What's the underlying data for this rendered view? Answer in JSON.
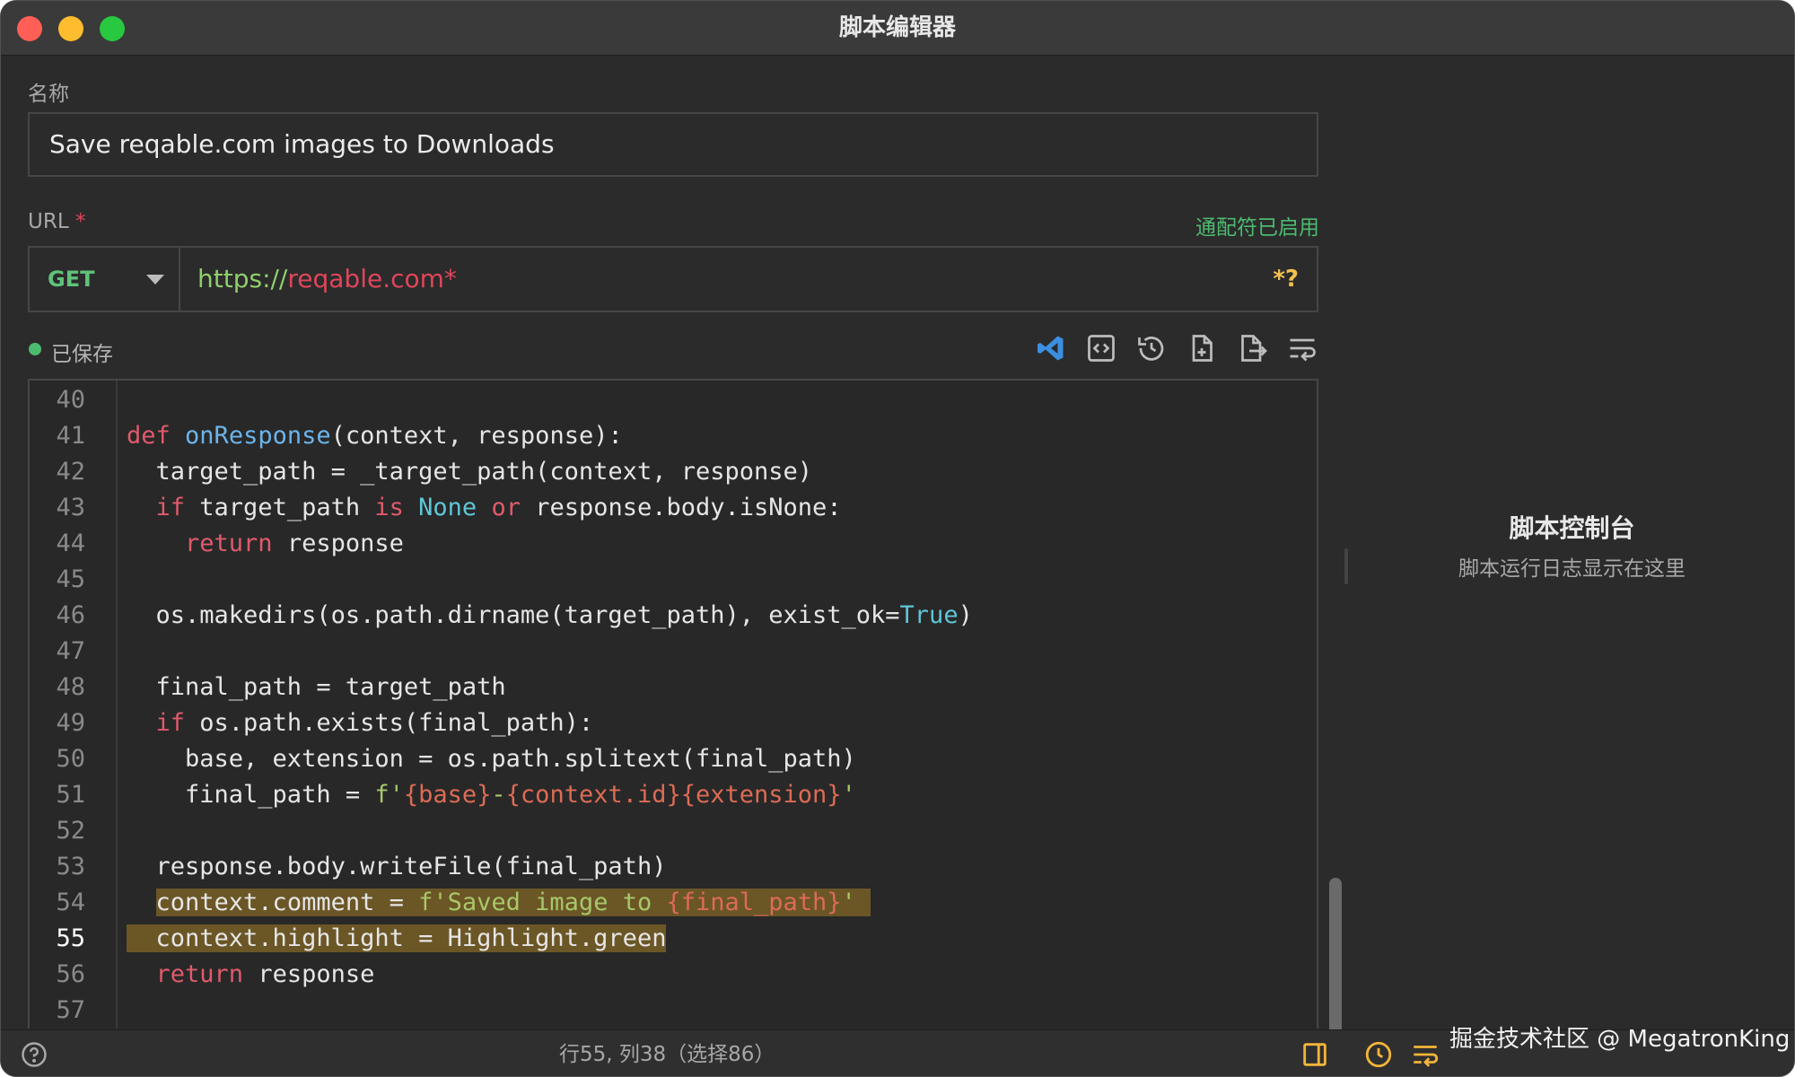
{
  "window": {
    "title": "脚本编辑器"
  },
  "form": {
    "name_label": "名称",
    "name_value": "Save reqable.com images to Downloads",
    "url_label": "URL",
    "url_required": "*",
    "wildcard_status": "通配符已启用",
    "method": "GET",
    "url_scheme": "https://",
    "url_host": "reqable.com*",
    "wildcard_button": "*?"
  },
  "status": {
    "saved": "已保存"
  },
  "toolbar": {
    "icons": [
      "vscode-icon",
      "code-block-icon",
      "history-icon",
      "import-file-icon",
      "export-file-icon",
      "word-wrap-icon"
    ]
  },
  "editor": {
    "current_line": 55,
    "lines": [
      {
        "n": 40,
        "tokens": []
      },
      {
        "n": 41,
        "tokens": [
          [
            "def",
            "k"
          ],
          [
            " ",
            ""
          ],
          [
            "onResponse",
            "f"
          ],
          [
            "(context, response):",
            ""
          ]
        ]
      },
      {
        "n": 42,
        "tokens": [
          [
            "  target_path = _target_path(context, response)",
            ""
          ]
        ]
      },
      {
        "n": 43,
        "tokens": [
          [
            "  ",
            ""
          ],
          [
            "if",
            "k"
          ],
          [
            " target_path ",
            ""
          ],
          [
            "is",
            "k"
          ],
          [
            " ",
            ""
          ],
          [
            "None",
            "c"
          ],
          [
            " ",
            ""
          ],
          [
            "or",
            "k"
          ],
          [
            " response.body.isNone:",
            ""
          ]
        ]
      },
      {
        "n": 44,
        "tokens": [
          [
            "    ",
            ""
          ],
          [
            "return",
            "k"
          ],
          [
            " response",
            ""
          ]
        ]
      },
      {
        "n": 45,
        "tokens": []
      },
      {
        "n": 46,
        "tokens": [
          [
            "  os.makedirs(os.path.dirname(target_path), exist_ok=",
            ""
          ],
          [
            "True",
            "c"
          ],
          [
            ")",
            ""
          ]
        ]
      },
      {
        "n": 47,
        "tokens": []
      },
      {
        "n": 48,
        "tokens": [
          [
            "  final_path = target_path",
            ""
          ]
        ]
      },
      {
        "n": 49,
        "tokens": [
          [
            "  ",
            ""
          ],
          [
            "if",
            "k"
          ],
          [
            " os.path.exists(final_path):",
            ""
          ]
        ]
      },
      {
        "n": 50,
        "tokens": [
          [
            "    base, extension = os.path.splitext(final_path)",
            ""
          ]
        ]
      },
      {
        "n": 51,
        "tokens": [
          [
            "    final_path = ",
            ""
          ],
          [
            "f'",
            "s"
          ],
          [
            "{base}",
            "i"
          ],
          [
            "-",
            "s"
          ],
          [
            "{context.id}",
            "i"
          ],
          [
            "{extension}",
            "i"
          ],
          [
            "'",
            "s"
          ]
        ]
      },
      {
        "n": 52,
        "tokens": []
      },
      {
        "n": 53,
        "tokens": [
          [
            "  response.body.writeFile(final_path)",
            ""
          ]
        ]
      },
      {
        "n": 54,
        "tokens": [
          [
            "  ",
            ""
          ],
          [
            "context.comment = ",
            "hl"
          ],
          [
            "f'Saved image to ",
            "s hl"
          ],
          [
            "{final_path}",
            "i hl"
          ],
          [
            "'",
            "s hl"
          ],
          [
            " ",
            "hl"
          ]
        ]
      },
      {
        "n": 55,
        "tokens": [
          [
            "  context.highlight = Highlight.green",
            "hl"
          ]
        ]
      },
      {
        "n": 56,
        "tokens": [
          [
            "  ",
            ""
          ],
          [
            "return",
            "k"
          ],
          [
            " response",
            ""
          ]
        ]
      },
      {
        "n": 57,
        "tokens": []
      }
    ]
  },
  "console": {
    "title": "脚本控制台",
    "subtitle": "脚本运行日志显示在这里"
  },
  "statusbar": {
    "cursor": "行55, 列38（选择86）",
    "watermark": "掘金技术社区 @ MegatronKing"
  },
  "colors": {
    "accent_green": "#4cbb6f",
    "keyword": "#e05a6b",
    "function": "#6cb4ea",
    "constant": "#5ec6d6",
    "string": "#a7c86a",
    "highlight": "#6b5626",
    "icon_yellow": "#f2b53a"
  }
}
